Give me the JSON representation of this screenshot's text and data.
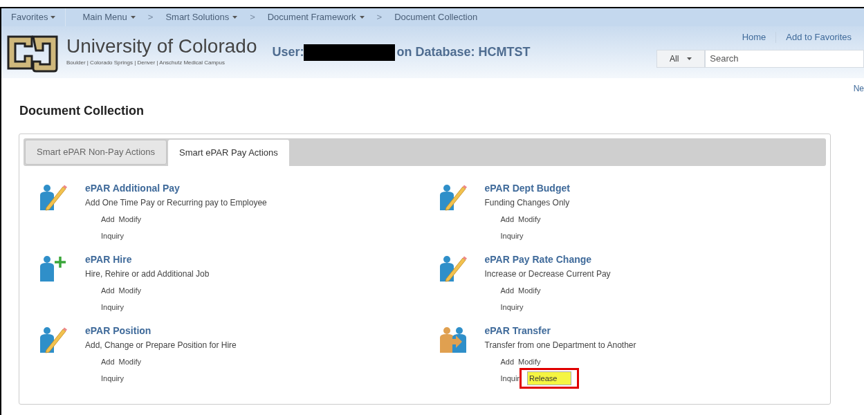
{
  "nav_bar": {
    "favorites": "Favorites",
    "breadcrumbs": [
      {
        "label": "Main Menu",
        "dropdown": true
      },
      {
        "separator": ">",
        "label": "Smart Solutions",
        "dropdown": true
      },
      {
        "separator": ">",
        "label": "Document Framework",
        "dropdown": true
      },
      {
        "separator": ">",
        "label": "Document Collection",
        "dropdown": false
      }
    ]
  },
  "header": {
    "university": "University of Colorado",
    "campuses": "Boulder | Colorado Springs | Denver | Anschutz Medical Campus",
    "user_label": "User:",
    "database": "on Database: HCMTST",
    "links": [
      "Home",
      "Add to Favorites"
    ],
    "search_scope": "All",
    "search_placeholder": "Search",
    "corner_link": "Ne"
  },
  "page_title": "Document Collection",
  "tabs": [
    {
      "label": "Smart ePAR Non-Pay Actions",
      "selected": false
    },
    {
      "label": "Smart ePAR Pay Actions",
      "selected": true
    }
  ],
  "items": [
    {
      "kind": "edit",
      "title": "ePAR Additional Pay",
      "description": "Add One Time Pay or Recurring pay to Employee",
      "actions": [
        [
          {
            "label": "Add",
            "highlighted": false
          },
          {
            "label": "Modify",
            "highlighted": false
          }
        ],
        [
          {
            "label": "Inquiry",
            "highlighted": false
          }
        ]
      ]
    },
    {
      "kind": "edit",
      "title": "ePAR Dept Budget",
      "description": "Funding Changes Only",
      "actions": [
        [
          {
            "label": "Add",
            "highlighted": false
          },
          {
            "label": "Modify",
            "highlighted": false
          }
        ],
        [
          {
            "label": "Inquiry",
            "highlighted": false
          }
        ]
      ]
    },
    {
      "kind": "add",
      "title": "ePAR Hire",
      "description": "Hire, Rehire or add Additional Job",
      "actions": [
        [
          {
            "label": "Add",
            "highlighted": false
          },
          {
            "label": "Modify",
            "highlighted": false
          }
        ],
        [
          {
            "label": "Inquiry",
            "highlighted": false
          }
        ]
      ]
    },
    {
      "kind": "edit",
      "title": "ePAR Pay Rate Change",
      "description": "Increase or Decrease Current Pay",
      "actions": [
        [
          {
            "label": "Add",
            "highlighted": false
          },
          {
            "label": "Modify",
            "highlighted": false
          }
        ],
        [
          {
            "label": "Inquiry",
            "highlighted": false
          }
        ]
      ]
    },
    {
      "kind": "edit",
      "title": "ePAR Position",
      "description": "Add, Change or Prepare Position for Hire",
      "actions": [
        [
          {
            "label": "Add",
            "highlighted": false
          },
          {
            "label": "Modify",
            "highlighted": false
          }
        ],
        [
          {
            "label": "Inquiry",
            "highlighted": false
          }
        ]
      ]
    },
    {
      "kind": "transfer",
      "title": "ePAR Transfer",
      "description": "Transfer from one Department to Another",
      "actions": [
        [
          {
            "label": "Add",
            "highlighted": false
          },
          {
            "label": "Modify",
            "highlighted": false
          }
        ],
        [
          {
            "label": "Inquir",
            "highlighted": false
          },
          {
            "label": "Release",
            "highlighted": true
          }
        ]
      ]
    }
  ]
}
